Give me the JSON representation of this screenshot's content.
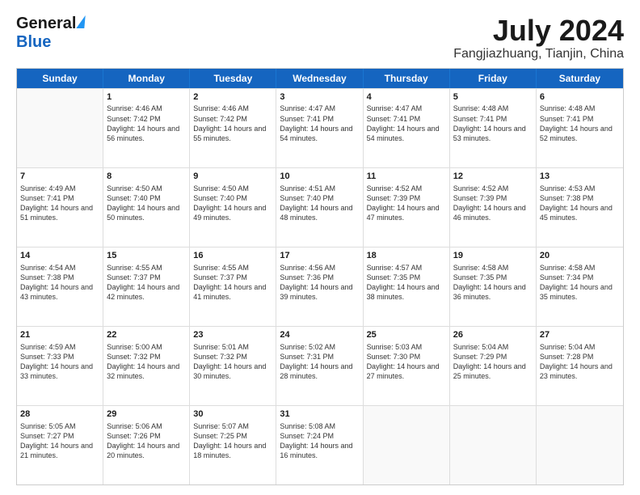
{
  "header": {
    "logo_line1": "General",
    "logo_line2": "Blue",
    "title": "July 2024",
    "subtitle": "Fangjiazhuang, Tianjin, China"
  },
  "calendar": {
    "days_of_week": [
      "Sunday",
      "Monday",
      "Tuesday",
      "Wednesday",
      "Thursday",
      "Friday",
      "Saturday"
    ],
    "rows": [
      [
        {
          "day": "",
          "empty": true
        },
        {
          "day": "1",
          "sunrise": "4:46 AM",
          "sunset": "7:42 PM",
          "daylight": "14 hours and 56 minutes."
        },
        {
          "day": "2",
          "sunrise": "4:46 AM",
          "sunset": "7:42 PM",
          "daylight": "14 hours and 55 minutes."
        },
        {
          "day": "3",
          "sunrise": "4:47 AM",
          "sunset": "7:41 PM",
          "daylight": "14 hours and 54 minutes."
        },
        {
          "day": "4",
          "sunrise": "4:47 AM",
          "sunset": "7:41 PM",
          "daylight": "14 hours and 54 minutes."
        },
        {
          "day": "5",
          "sunrise": "4:48 AM",
          "sunset": "7:41 PM",
          "daylight": "14 hours and 53 minutes."
        },
        {
          "day": "6",
          "sunrise": "4:48 AM",
          "sunset": "7:41 PM",
          "daylight": "14 hours and 52 minutes."
        }
      ],
      [
        {
          "day": "7",
          "sunrise": "4:49 AM",
          "sunset": "7:41 PM",
          "daylight": "14 hours and 51 minutes."
        },
        {
          "day": "8",
          "sunrise": "4:50 AM",
          "sunset": "7:40 PM",
          "daylight": "14 hours and 50 minutes."
        },
        {
          "day": "9",
          "sunrise": "4:50 AM",
          "sunset": "7:40 PM",
          "daylight": "14 hours and 49 minutes."
        },
        {
          "day": "10",
          "sunrise": "4:51 AM",
          "sunset": "7:40 PM",
          "daylight": "14 hours and 48 minutes."
        },
        {
          "day": "11",
          "sunrise": "4:52 AM",
          "sunset": "7:39 PM",
          "daylight": "14 hours and 47 minutes."
        },
        {
          "day": "12",
          "sunrise": "4:52 AM",
          "sunset": "7:39 PM",
          "daylight": "14 hours and 46 minutes."
        },
        {
          "day": "13",
          "sunrise": "4:53 AM",
          "sunset": "7:38 PM",
          "daylight": "14 hours and 45 minutes."
        }
      ],
      [
        {
          "day": "14",
          "sunrise": "4:54 AM",
          "sunset": "7:38 PM",
          "daylight": "14 hours and 43 minutes."
        },
        {
          "day": "15",
          "sunrise": "4:55 AM",
          "sunset": "7:37 PM",
          "daylight": "14 hours and 42 minutes."
        },
        {
          "day": "16",
          "sunrise": "4:55 AM",
          "sunset": "7:37 PM",
          "daylight": "14 hours and 41 minutes."
        },
        {
          "day": "17",
          "sunrise": "4:56 AM",
          "sunset": "7:36 PM",
          "daylight": "14 hours and 39 minutes."
        },
        {
          "day": "18",
          "sunrise": "4:57 AM",
          "sunset": "7:35 PM",
          "daylight": "14 hours and 38 minutes."
        },
        {
          "day": "19",
          "sunrise": "4:58 AM",
          "sunset": "7:35 PM",
          "daylight": "14 hours and 36 minutes."
        },
        {
          "day": "20",
          "sunrise": "4:58 AM",
          "sunset": "7:34 PM",
          "daylight": "14 hours and 35 minutes."
        }
      ],
      [
        {
          "day": "21",
          "sunrise": "4:59 AM",
          "sunset": "7:33 PM",
          "daylight": "14 hours and 33 minutes."
        },
        {
          "day": "22",
          "sunrise": "5:00 AM",
          "sunset": "7:32 PM",
          "daylight": "14 hours and 32 minutes."
        },
        {
          "day": "23",
          "sunrise": "5:01 AM",
          "sunset": "7:32 PM",
          "daylight": "14 hours and 30 minutes."
        },
        {
          "day": "24",
          "sunrise": "5:02 AM",
          "sunset": "7:31 PM",
          "daylight": "14 hours and 28 minutes."
        },
        {
          "day": "25",
          "sunrise": "5:03 AM",
          "sunset": "7:30 PM",
          "daylight": "14 hours and 27 minutes."
        },
        {
          "day": "26",
          "sunrise": "5:04 AM",
          "sunset": "7:29 PM",
          "daylight": "14 hours and 25 minutes."
        },
        {
          "day": "27",
          "sunrise": "5:04 AM",
          "sunset": "7:28 PM",
          "daylight": "14 hours and 23 minutes."
        }
      ],
      [
        {
          "day": "28",
          "sunrise": "5:05 AM",
          "sunset": "7:27 PM",
          "daylight": "14 hours and 21 minutes."
        },
        {
          "day": "29",
          "sunrise": "5:06 AM",
          "sunset": "7:26 PM",
          "daylight": "14 hours and 20 minutes."
        },
        {
          "day": "30",
          "sunrise": "5:07 AM",
          "sunset": "7:25 PM",
          "daylight": "14 hours and 18 minutes."
        },
        {
          "day": "31",
          "sunrise": "5:08 AM",
          "sunset": "7:24 PM",
          "daylight": "14 hours and 16 minutes."
        },
        {
          "day": "",
          "empty": true
        },
        {
          "day": "",
          "empty": true
        },
        {
          "day": "",
          "empty": true
        }
      ]
    ]
  }
}
